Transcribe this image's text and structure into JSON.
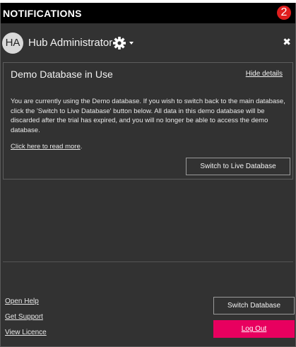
{
  "header": {
    "title": "NOTIFICATIONS",
    "badge_count": "2",
    "badge_color": "#e01e1e"
  },
  "user": {
    "initials": "HA",
    "name": "Hub Administrator",
    "menu_icon": "gear-icon",
    "close_symbol": "✖"
  },
  "notice": {
    "title": "Demo Database in Use",
    "hide_label": "Hide details",
    "body": "You are currently using the Demo database. If you wish to switch back to the main database, click the 'Switch to Live Database' button below. All data in this demo database will be discarded after the trial has expired, and you will no longer be able to access the demo database.",
    "read_more_label": "Click here to read more",
    "read_more_suffix": ".",
    "switch_live_label": "Switch to Live Database"
  },
  "footer": {
    "links": {
      "help": "Open Help",
      "support": "Get Support",
      "licence": "View Licence"
    },
    "switch_db_label": "Switch Database",
    "logout_label": "Log Out",
    "logout_color": "#e8005f"
  }
}
